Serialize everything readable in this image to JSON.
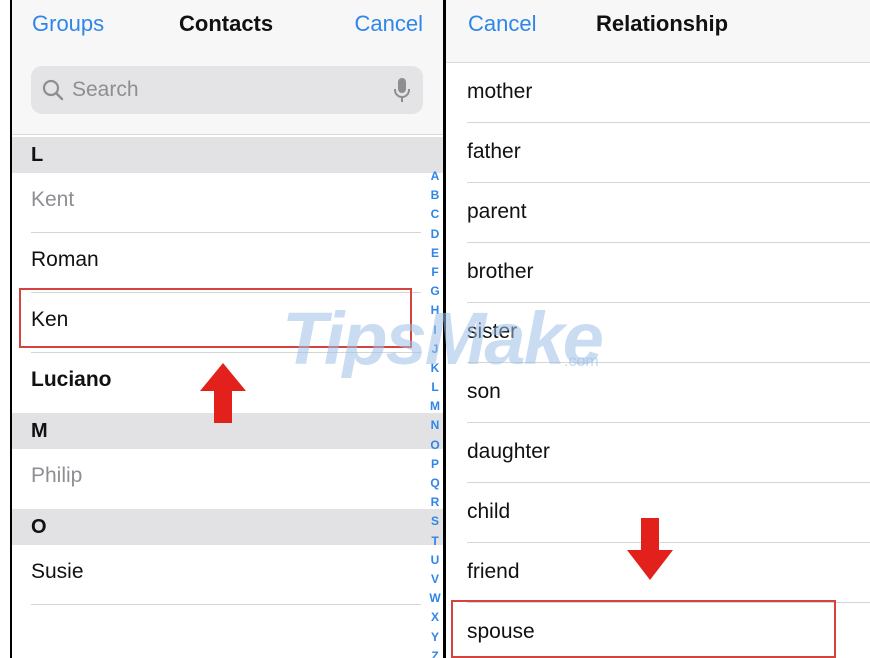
{
  "contacts_pane": {
    "groups_label": "Groups",
    "title": "Contacts",
    "cancel_label": "Cancel",
    "search_placeholder": "Search",
    "sections": [
      {
        "letter": "L",
        "contacts": [
          {
            "name": "Kent",
            "muted": true
          },
          {
            "name": "Roman",
            "muted": false
          },
          {
            "name": "Ken",
            "muted": false
          },
          {
            "name": "Luciano",
            "muted": false,
            "bold": true
          }
        ]
      },
      {
        "letter": "M",
        "contacts": [
          {
            "name": "Philip",
            "muted": true
          }
        ]
      },
      {
        "letter": "O",
        "contacts": [
          {
            "name": "Susie",
            "muted": false
          }
        ]
      }
    ],
    "index_letters": [
      "A",
      "B",
      "C",
      "D",
      "E",
      "F",
      "G",
      "H",
      "I",
      "J",
      "K",
      "L",
      "M",
      "N",
      "O",
      "P",
      "Q",
      "R",
      "S",
      "T",
      "U",
      "V",
      "W",
      "X",
      "Y",
      "Z"
    ]
  },
  "relationship_pane": {
    "cancel_label": "Cancel",
    "title": "Relationship",
    "items": [
      "mother",
      "father",
      "parent",
      "brother",
      "sister",
      "son",
      "daughter",
      "child",
      "friend",
      "spouse"
    ]
  },
  "watermark": {
    "text": "TipsMake",
    "suffix": ".com"
  },
  "colors": {
    "accent": "#2f86e8",
    "highlight": "#d3443f",
    "arrow": "#e2211c",
    "section_bg": "#e2e2e4"
  }
}
